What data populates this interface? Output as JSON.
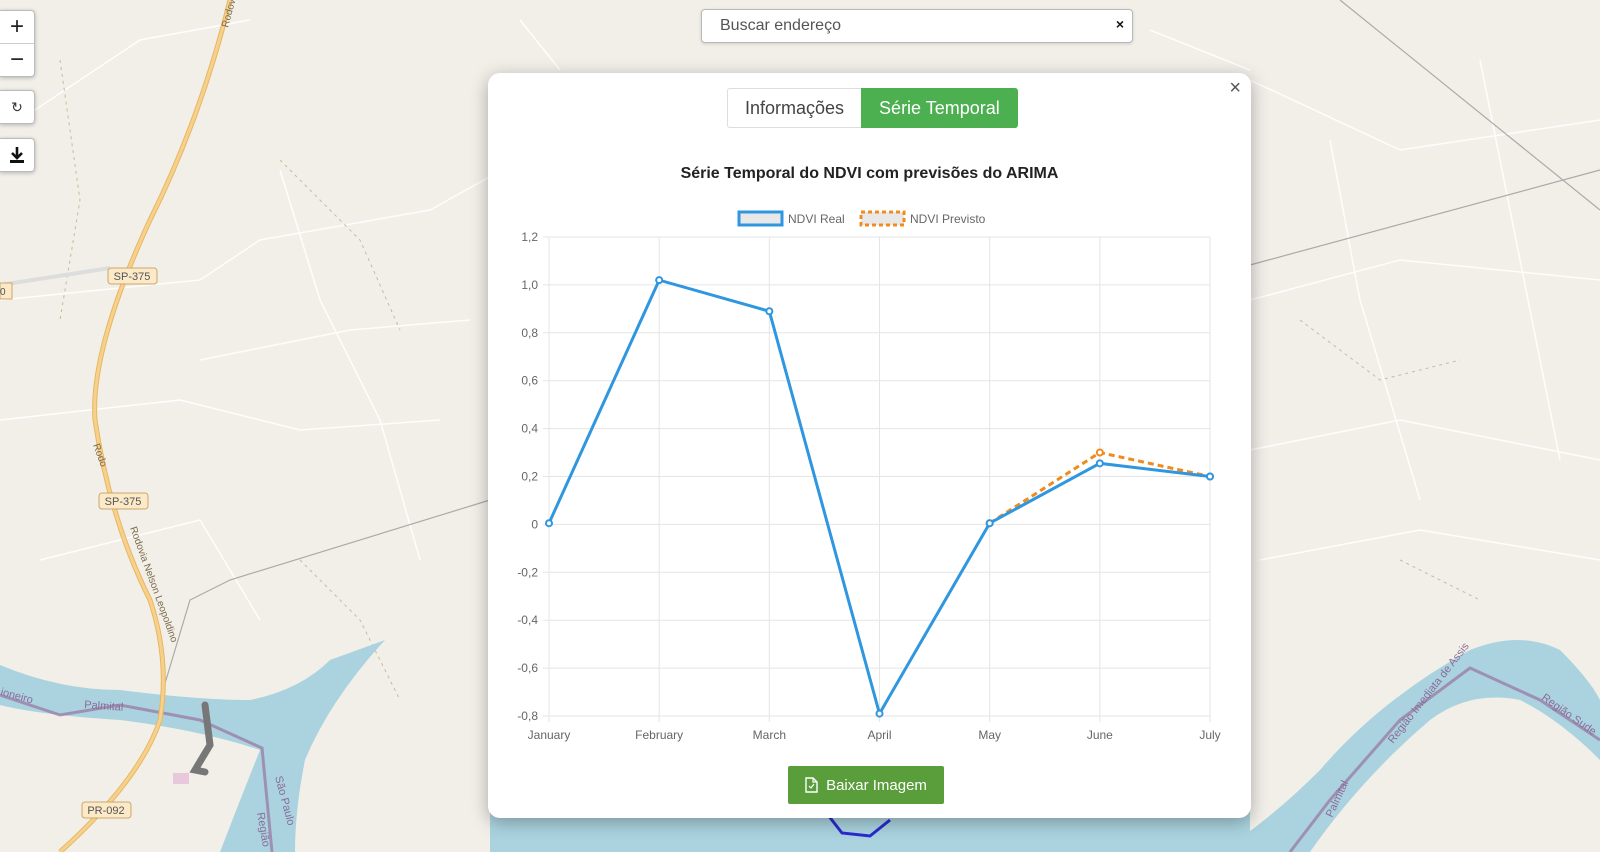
{
  "search": {
    "placeholder": "Buscar endereço",
    "clear": "×"
  },
  "map_controls": {
    "zoom_in": "+",
    "zoom_out": "−",
    "refresh": "↻"
  },
  "map_labels": {
    "road_sp375_a": "SP-375",
    "road_sp375_b": "SP-375",
    "road_pr092": "PR-092",
    "road_rodov_top": "Rodov",
    "road_rodo": "Rodo",
    "road_nelson": "Rodovia Nelson Leopoldino",
    "river_palmital": "Palmital",
    "river_left": "ioneiro",
    "sao_paulo": "São Paulo",
    "regiao_left": "Região",
    "regiao_imediata": "Região Imediata de Assis",
    "regiao_sudeste": "Região Sude",
    "palmital_right": "Palmital",
    "edge_number": "0"
  },
  "modal": {
    "close": "×",
    "tabs": [
      {
        "label": "Informações",
        "active": false
      },
      {
        "label": "Série Temporal",
        "active": true
      }
    ],
    "download_label": "Baixar Imagem"
  },
  "colors": {
    "tab_active": "#4caf50",
    "real_line": "#2f96e0",
    "forecast_line": "#f08c1e",
    "download_button": "#5a9e3c",
    "water": "#aad3df"
  },
  "chart_data": {
    "type": "line",
    "title": "Série Temporal do NDVI com previsões do ARIMA",
    "categories": [
      "January",
      "February",
      "March",
      "April",
      "May",
      "June",
      "July"
    ],
    "series": [
      {
        "name": "NDVI Real",
        "values": [
          0.005,
          1.02,
          0.89,
          -0.79,
          0.005,
          0.255,
          0.2
        ],
        "style": "solid"
      },
      {
        "name": "NDVI Previsto",
        "values": [
          null,
          null,
          null,
          null,
          0.005,
          0.3,
          0.2
        ],
        "style": "dashed"
      }
    ],
    "y_ticks": [
      "1,2",
      "1,0",
      "0,8",
      "0,6",
      "0,4",
      "0,2",
      "0",
      "-0,2",
      "-0,4",
      "-0,6",
      "-0,8"
    ],
    "ylim": [
      -0.8,
      1.2
    ],
    "xlabel": "",
    "ylabel": "",
    "grid": true,
    "legend_position": "top"
  }
}
